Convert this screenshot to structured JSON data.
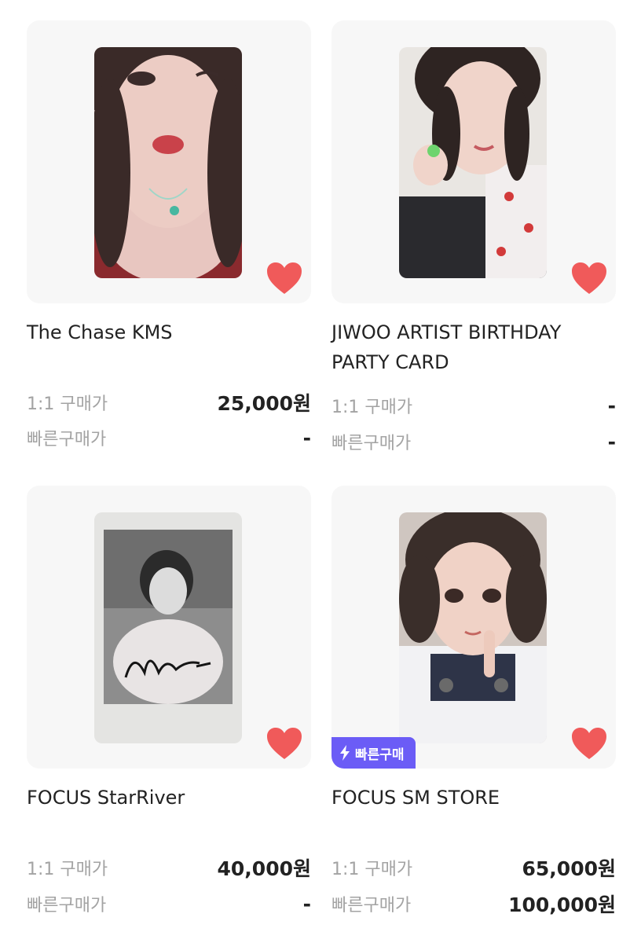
{
  "products": [
    {
      "title": "The Chase KMS",
      "price_1to1_label": "1:1 구매가",
      "price_1to1": "25,000원",
      "quick_price_label": "빠른구매가",
      "quick_price": "-",
      "liked": true,
      "quick_badge": null
    },
    {
      "title": "JIWOO ARTIST BIRTHDAY PARTY CARD",
      "price_1to1_label": "1:1 구매가",
      "price_1to1": "-",
      "quick_price_label": "빠른구매가",
      "quick_price": "-",
      "liked": true,
      "quick_badge": null
    },
    {
      "title": "FOCUS StarRiver",
      "price_1to1_label": "1:1 구매가",
      "price_1to1": "40,000원",
      "quick_price_label": "빠른구매가",
      "quick_price": "-",
      "liked": true,
      "quick_badge": null
    },
    {
      "title": "FOCUS SM STORE",
      "price_1to1_label": "1:1 구매가",
      "price_1to1": "65,000원",
      "quick_price_label": "빠른구매가",
      "quick_price": "100,000원",
      "liked": true,
      "quick_badge": "빠른구매"
    }
  ],
  "colors": {
    "heart": "#f05a5a",
    "badge": "#6b5cf6",
    "label_gray": "#a3a3a3"
  },
  "icons": {
    "like": "heart-icon",
    "quick": "lightning-icon"
  }
}
